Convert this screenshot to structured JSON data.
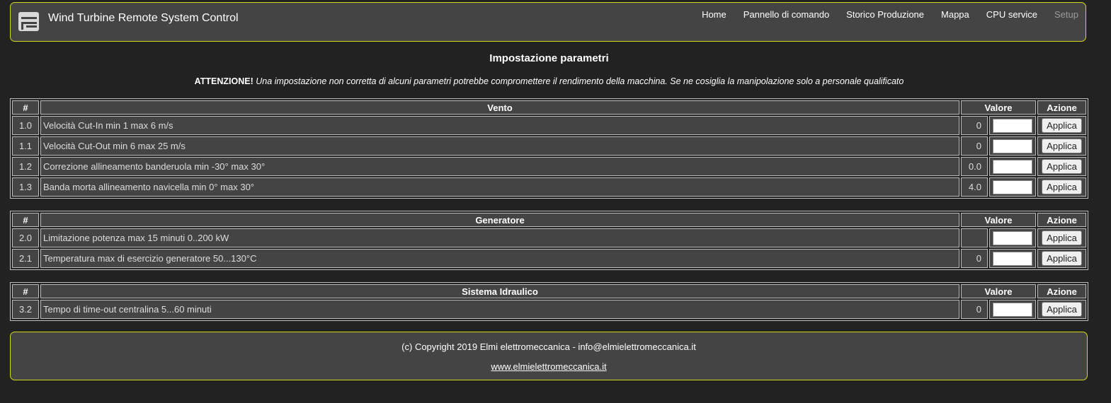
{
  "header": {
    "title": "Wind Turbine Remote System Control",
    "nav": [
      "Home",
      "Pannello di comando",
      "Storico Produzione",
      "Mappa",
      "CPU service",
      "Setup"
    ]
  },
  "page": {
    "title": "Impostazione parametri",
    "warning_strong": "ATTENZIONE!",
    "warning_text": "Una impostazione non corretta di alcuni parametri potrebbe compromettere il rendimento della macchina. Se ne cosiglia la manipolazione solo a personale qualificato"
  },
  "sections": [
    {
      "headers": [
        "#",
        "Vento",
        "Valore",
        "Azione"
      ],
      "rows": [
        {
          "num": "1.0",
          "desc": "Velocità Cut-In min 1 max 6 m/s",
          "value": "0",
          "button": "Applica"
        },
        {
          "num": "1.1",
          "desc": "Velocità Cut-Out min 6 max 25 m/s",
          "value": "0",
          "button": "Applica"
        },
        {
          "num": "1.2",
          "desc": "Correzione allineamento banderuola min -30° max 30°",
          "value": "0.0",
          "button": "Applica"
        },
        {
          "num": "1.3",
          "desc": "Banda morta allineamento navicella min 0° max 30°",
          "value": "4.0",
          "button": "Applica"
        }
      ]
    },
    {
      "headers": [
        "#",
        "Generatore",
        "Valore",
        "Azione"
      ],
      "rows": [
        {
          "num": "2.0",
          "desc": "Limitazione potenza max 15 minuti 0..200 kW",
          "value": "",
          "button": "Applica"
        },
        {
          "num": "2.1",
          "desc": "Temperatura max di esercizio generatore 50...130°C",
          "value": "0",
          "button": "Applica"
        }
      ]
    },
    {
      "headers": [
        "#",
        "Sistema Idraulico",
        "Valore",
        "Azione"
      ],
      "rows": [
        {
          "num": "3.2",
          "desc": "Tempo di time-out centralina 5...60 minuti",
          "value": "0",
          "button": "Applica"
        }
      ]
    }
  ],
  "footer": {
    "copyright": "(c) Copyright 2019 Elmi elettromeccanica - info@elmielettromeccanica.it",
    "website": "www.elmielettromeccanica.it"
  },
  "colors": {
    "accent_border": "#d6d61f",
    "panel": "#444444",
    "background": "#222222"
  }
}
